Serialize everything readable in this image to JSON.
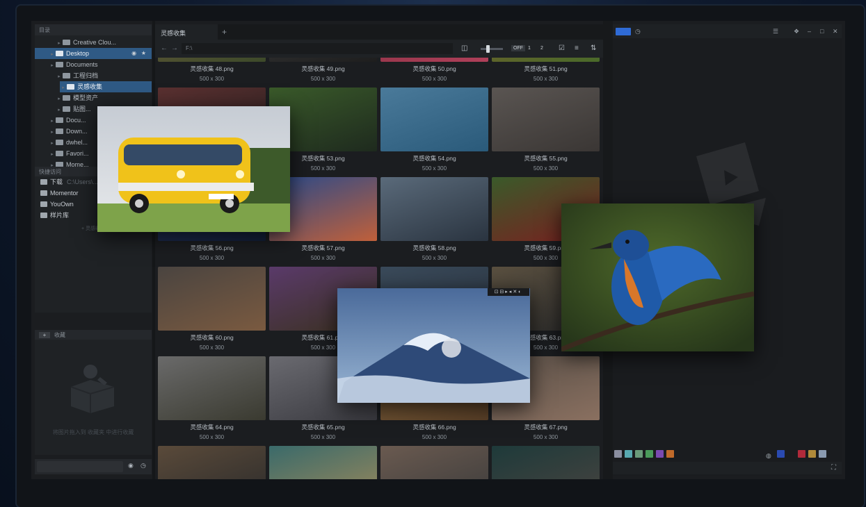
{
  "sidebar": {
    "header": "目录",
    "tree": [
      {
        "label": "Creative Clou...",
        "indent": 3
      },
      {
        "label": "Desktop",
        "indent": 2,
        "selected": true
      },
      {
        "label": "Documents",
        "indent": 2
      },
      {
        "label": "工程归档",
        "indent": 3
      },
      {
        "label": "灵感收集",
        "indent": 3,
        "selected": true
      },
      {
        "label": "模型资产",
        "indent": 3
      },
      {
        "label": "贴图...",
        "indent": 3
      },
      {
        "label": "Docu...",
        "indent": 2
      },
      {
        "label": "Down...",
        "indent": 2
      },
      {
        "label": "dwhel...",
        "indent": 2
      },
      {
        "label": "Favori...",
        "indent": 2
      },
      {
        "label": "Mome...",
        "indent": 2
      }
    ],
    "quick_header": "快捷访问",
    "quick": [
      {
        "label": "下载",
        "path": "C:\\Users\\..."
      },
      {
        "label": "Momentor",
        "path": ""
      },
      {
        "label": "YouOwn",
        "path": ""
      },
      {
        "label": "样片库",
        "path": ""
      }
    ],
    "quick_add": "+ 灵感收集",
    "collection_header": "收藏",
    "collection_add": "+",
    "collection_hint": "将图片拖入到 收藏夹 中进行收藏"
  },
  "tab": {
    "label": "灵感收集",
    "add": "+"
  },
  "toolbar": {
    "back": "←",
    "forward": "→",
    "path": "F:\\",
    "off": "OFF",
    "p1": "1",
    "p2": "2"
  },
  "grid": [
    {
      "name": "灵感收集 48.png",
      "size": "500 x 300"
    },
    {
      "name": "灵感收集 49.png",
      "size": "500 x 300"
    },
    {
      "name": "灵感收集 50.png",
      "size": "500 x 300"
    },
    {
      "name": "灵感收集 51.png",
      "size": "500 x 300"
    },
    {
      "name": "灵感收集 52.png",
      "size": "500 x 300"
    },
    {
      "name": "灵感收集 53.png",
      "size": "500 x 300"
    },
    {
      "name": "灵感收集 54.png",
      "size": "500 x 300"
    },
    {
      "name": "灵感收集 55.png",
      "size": "500 x 300"
    },
    {
      "name": "灵感收集 56.png",
      "size": "500 x 300"
    },
    {
      "name": "灵感收集 57.png",
      "size": "500 x 300"
    },
    {
      "name": "灵感收集 58.png",
      "size": "500 x 300"
    },
    {
      "name": "灵感收集 59.png",
      "size": "500 x 300"
    },
    {
      "name": "灵感收集 60.png",
      "size": "500 x 300"
    },
    {
      "name": "灵感收集 61.png",
      "size": "500 x 300"
    },
    {
      "name": "灵感收集 62.png",
      "size": "500 x 300"
    },
    {
      "name": "灵感收集 63.png",
      "size": "500 x 300"
    },
    {
      "name": "灵感收集 64.png",
      "size": "500 x 300"
    },
    {
      "name": "灵感收集 65.png",
      "size": "500 x 300"
    },
    {
      "name": "灵感收集 66.png",
      "size": "500 x 300"
    },
    {
      "name": "灵感收集 67.png",
      "size": "500 x 300"
    },
    {
      "name": "",
      "size": ""
    },
    {
      "name": "",
      "size": ""
    },
    {
      "name": "",
      "size": ""
    },
    {
      "name": "",
      "size": ""
    }
  ],
  "thumb_colors": [
    [
      "#6a5a3a",
      "#3d4a2a"
    ],
    [
      "#3a3a3a",
      "#1e1e1e"
    ],
    [
      "#7a2a3a",
      "#b0405a"
    ],
    [
      "#7a5a2a",
      "#4a6a2a"
    ],
    [
      "#5a3030",
      "#2a2020"
    ],
    [
      "#3a5a2a",
      "#1e2a1e"
    ],
    [
      "#4a7a9a",
      "#2a5a7a"
    ],
    [
      "#5a5552",
      "#3a3634"
    ],
    [
      "#2a3a6a",
      "#14203a"
    ],
    [
      "#2a4a8a",
      "#c0603a"
    ],
    [
      "#5a6a7a",
      "#2a3440"
    ],
    [
      "#3a5a2a",
      "#7a2020"
    ],
    [
      "#4a4440",
      "#7a5a40"
    ],
    [
      "#5a3a6a",
      "#3a3020"
    ],
    [
      "#3a4a5a",
      "#2a3440"
    ],
    [
      "#5a5040",
      "#2a2a2a"
    ],
    [
      "#6a6a6a",
      "#3a3a30"
    ],
    [
      "#6a6a70",
      "#3a3a40"
    ],
    [
      "#8a6a40",
      "#5a4028"
    ],
    [
      "#5a5048",
      "#8a7060"
    ],
    [
      "#5a4a3a",
      "#2a2a2a"
    ],
    [
      "#3a6a6a",
      "#a08a5a"
    ],
    [
      "#6a5a50",
      "#3a3a3a"
    ],
    [
      "#1e3a3a",
      "#4a4440"
    ]
  ],
  "right_panel": {
    "tag": "预览"
  },
  "swatches": [
    "#8a8ea0",
    "#58a8b0",
    "#6a9a7a",
    "#4a9a5a",
    "#7a4ab0",
    "#c06a2a"
  ],
  "swatches_right": [
    "#2a4ab0",
    "#1a1c1f",
    "#b02a3a",
    "#b08a3a",
    "#8a9ab0"
  ],
  "overlay_tools": "⊡⊟▸◂✕◐"
}
